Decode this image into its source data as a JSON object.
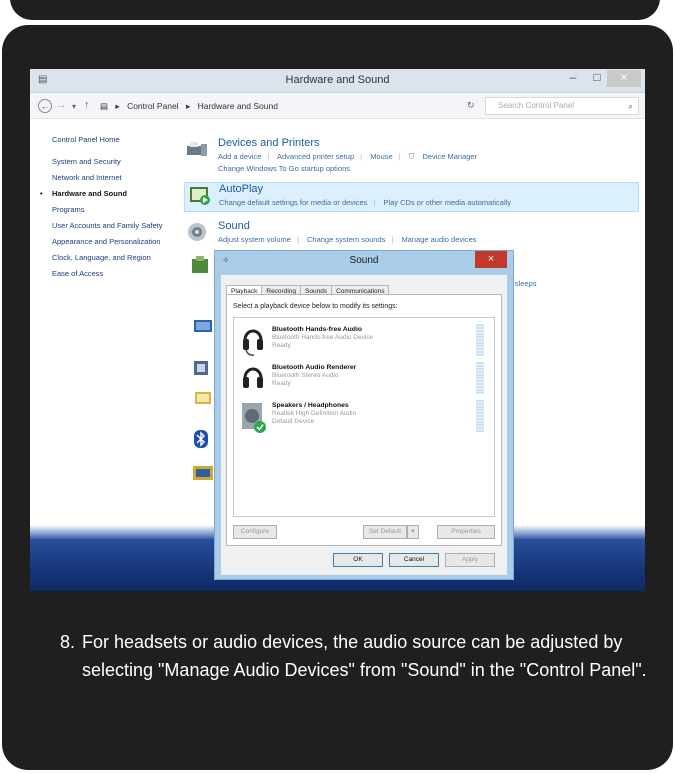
{
  "window": {
    "title": "Hardware and Sound",
    "min_glyph": "–",
    "max_glyph": "□",
    "close_glyph": "×"
  },
  "nav": {
    "back": "←",
    "forward": "→",
    "recent": "▾",
    "up": "↑",
    "refresh": "↻",
    "location_icon": "▤"
  },
  "breadcrumb": [
    "▸",
    "Control Panel",
    "▸",
    "Hardware and Sound"
  ],
  "search": {
    "placeholder": "Search Control Panel",
    "icon": "⌕"
  },
  "sidebar": {
    "items": [
      {
        "label": "Control Panel Home"
      },
      {
        "label": "System and Security"
      },
      {
        "label": "Network and Internet"
      },
      {
        "label": "Hardware and Sound"
      },
      {
        "label": "Programs"
      },
      {
        "label": "User Accounts and Family Safety"
      },
      {
        "label": "Appearance and Personalization"
      },
      {
        "label": "Clock, Language, and Region"
      },
      {
        "label": "Ease of Access"
      }
    ]
  },
  "categories": {
    "devices": {
      "title": "Devices and Printers",
      "links": [
        "Add a device",
        "Advanced printer setup",
        "Mouse",
        "Device Manager"
      ],
      "links2": [
        "Change Windows To Go startup options"
      ]
    },
    "autoplay": {
      "title": "AutoPlay",
      "links": [
        "Change default settings for media or devices",
        "Play CDs or other media automatically"
      ]
    },
    "sound": {
      "title": "Sound",
      "links": [
        "Adjust system volume",
        "Change system sounds",
        "Manage audio devices"
      ]
    },
    "power_partial": "ter sleeps"
  },
  "sound_dialog": {
    "title": "Sound",
    "close": "×",
    "tabs": [
      "Playback",
      "Recording",
      "Sounds",
      "Communications"
    ],
    "instruction": "Select a playback device below to modify its settings:",
    "devices": [
      {
        "name": "Bluetooth Hands-free Audio",
        "desc": "Bluetooth Hands-free Audio Device",
        "status": "Ready",
        "icon": "headset-icon"
      },
      {
        "name": "Bluetooth Audio Renderer",
        "desc": "Bluetooth Stereo Audio",
        "status": "Ready",
        "icon": "headset-icon"
      },
      {
        "name": "Speakers / Headphones",
        "desc": "Realtek High Definition Audio",
        "status": "Default Device",
        "icon": "speaker-icon"
      }
    ],
    "configure": "Configure",
    "set_default": "Set Default",
    "set_default_arrow": "▾",
    "properties": "Properties",
    "ok": "OK",
    "cancel": "Cancel",
    "apply": "Apply"
  },
  "caption": {
    "number": "8.",
    "text": "For headsets or audio devices, the audio source can be adjusted by  selecting \"Manage Audio Devices\" from \"Sound\" in the \"Control Panel\"."
  },
  "colors": {
    "frame": "#1f1f1f",
    "link": "#3a6ea5",
    "category_title": "#1e5a9c",
    "highlight": "#dceffc",
    "dialog_border": "#a9cde9",
    "close_red": "#c0392b"
  }
}
